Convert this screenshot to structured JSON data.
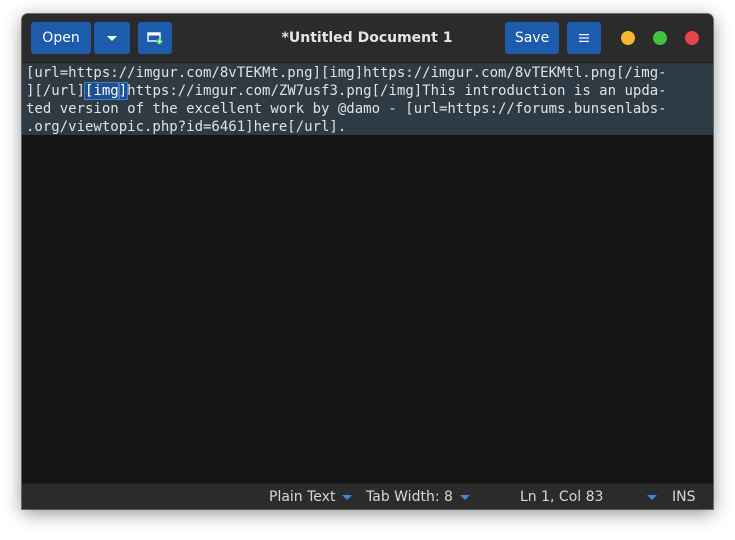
{
  "header": {
    "title": "*Untitled Document 1",
    "open_label": "Open",
    "save_label": "Save"
  },
  "editor": {
    "line1": "[url=https://imgur.com/8vTEKMt.png][img]https://imgur.com/8vTEKMtl.png[/img-",
    "line2_pre": "][/url]",
    "line2_match1": "[img",
    "line2_match2": "]",
    "line2_post": "https://imgur.com/ZW7usf3.png[/img]This introduction is an upda-",
    "line3": "ted version of the excellent work by @damo - [url=https://forums.bunsenlabs-",
    "line4": ".org/viewtopic.php?id=6461]here[/url]."
  },
  "status": {
    "language": "Plain Text",
    "tab_width": "Tab Width: 8",
    "position": "Ln 1, Col 83",
    "mode": "INS"
  },
  "colors": {
    "accent": "#1d5cad",
    "minimize": "#f5b831",
    "maximize": "#3fc341",
    "close": "#e8434b"
  },
  "icons": [
    "open-menu-chevron",
    "new-document-icon",
    "hamburger-menu-icon"
  ]
}
